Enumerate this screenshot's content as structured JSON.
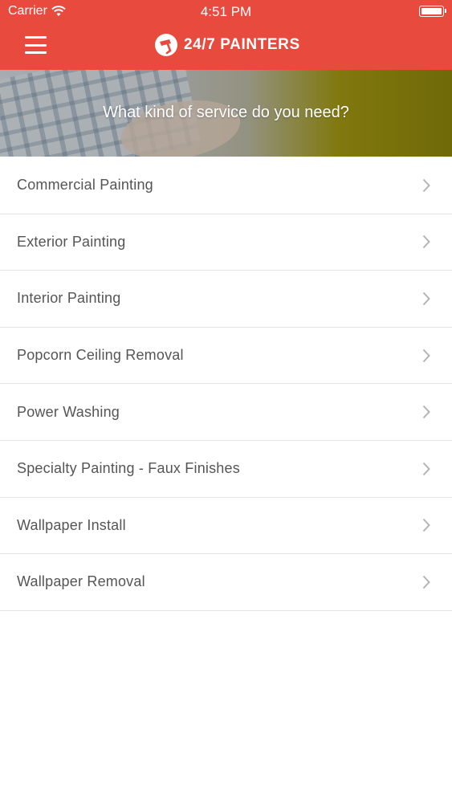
{
  "status_bar": {
    "carrier": "Carrier",
    "time": "4:51 PM",
    "wifi_icon": "wifi-icon",
    "battery_icon": "battery-full-icon"
  },
  "nav": {
    "menu_icon": "hamburger-menu-icon",
    "logo_icon": "paint-roller-logo-icon",
    "brand_name": "24/7 PAINTERS",
    "brand_color": "#e84b3e"
  },
  "hero": {
    "title": "What kind of service do you need?"
  },
  "services": {
    "chevron_icon": "chevron-right-icon",
    "items": [
      {
        "label": "Commercial Painting"
      },
      {
        "label": "Exterior Painting"
      },
      {
        "label": "Interior Painting"
      },
      {
        "label": "Popcorn Ceiling Removal"
      },
      {
        "label": "Power Washing"
      },
      {
        "label": "Specialty Painting - Faux Finishes"
      },
      {
        "label": "Wallpaper Install"
      },
      {
        "label": "Wallpaper Removal"
      }
    ]
  }
}
